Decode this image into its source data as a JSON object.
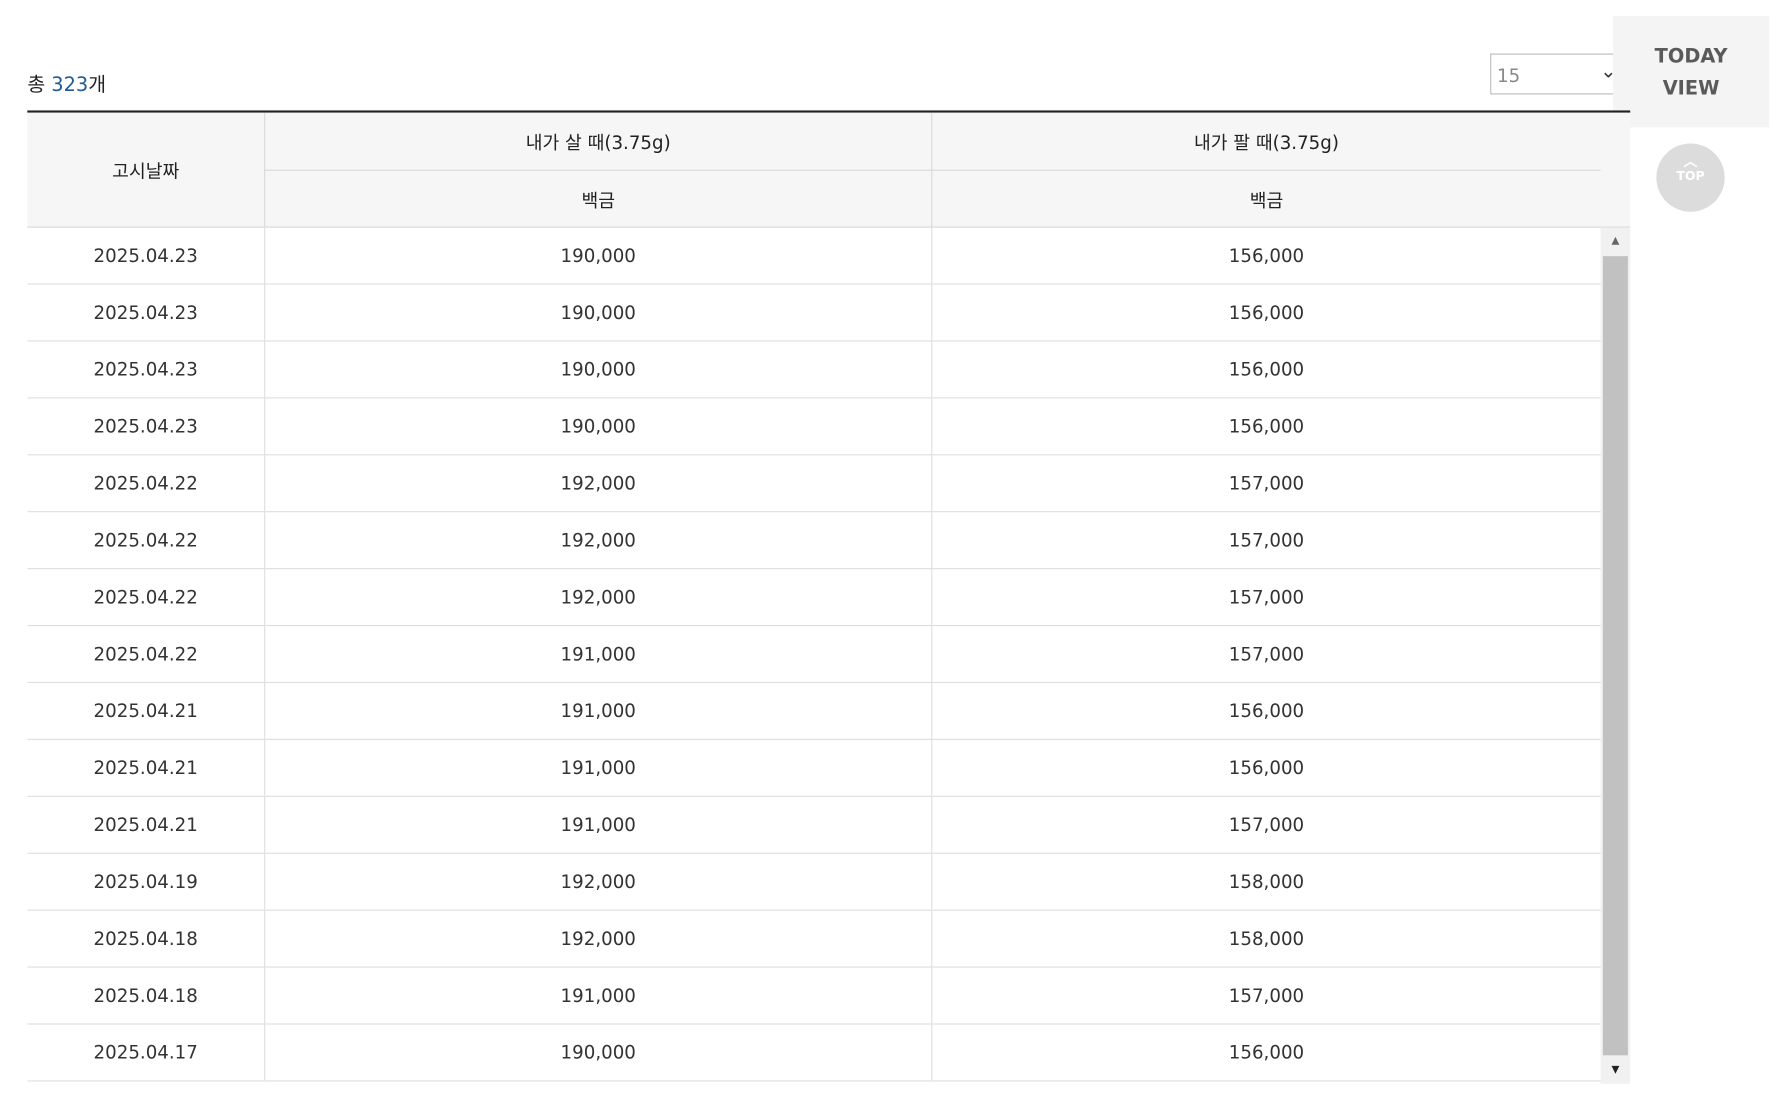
{
  "summary": {
    "prefix": "총 ",
    "count": "323",
    "suffix": "개"
  },
  "page_size": {
    "selected": "15",
    "chevron_icon": "chevron-down-icon"
  },
  "side": {
    "today_line1": "TODAY",
    "today_line2": "VIEW",
    "top_label": "TOP",
    "top_icon": "chevron-up-icon"
  },
  "table": {
    "headers": {
      "date": "고시날짜",
      "buy": "내가 살 때(3.75g)",
      "sell": "내가 팔 때(3.75g)",
      "buy_sub": "백금",
      "sell_sub": "백금"
    },
    "rows": [
      {
        "date": "2025.04.23",
        "buy": "190,000",
        "sell": "156,000"
      },
      {
        "date": "2025.04.23",
        "buy": "190,000",
        "sell": "156,000"
      },
      {
        "date": "2025.04.23",
        "buy": "190,000",
        "sell": "156,000"
      },
      {
        "date": "2025.04.23",
        "buy": "190,000",
        "sell": "156,000"
      },
      {
        "date": "2025.04.22",
        "buy": "192,000",
        "sell": "157,000"
      },
      {
        "date": "2025.04.22",
        "buy": "192,000",
        "sell": "157,000"
      },
      {
        "date": "2025.04.22",
        "buy": "192,000",
        "sell": "157,000"
      },
      {
        "date": "2025.04.22",
        "buy": "191,000",
        "sell": "157,000"
      },
      {
        "date": "2025.04.21",
        "buy": "191,000",
        "sell": "156,000"
      },
      {
        "date": "2025.04.21",
        "buy": "191,000",
        "sell": "156,000"
      },
      {
        "date": "2025.04.21",
        "buy": "191,000",
        "sell": "157,000"
      },
      {
        "date": "2025.04.19",
        "buy": "192,000",
        "sell": "158,000"
      },
      {
        "date": "2025.04.18",
        "buy": "192,000",
        "sell": "158,000"
      },
      {
        "date": "2025.04.18",
        "buy": "191,000",
        "sell": "157,000"
      },
      {
        "date": "2025.04.17",
        "buy": "190,000",
        "sell": "156,000"
      }
    ]
  }
}
